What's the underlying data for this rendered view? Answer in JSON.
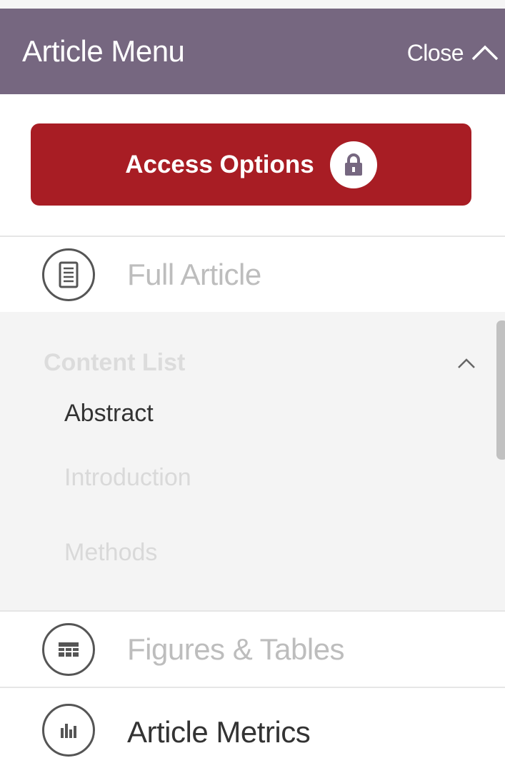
{
  "header": {
    "title": "Article Menu",
    "close_label": "Close"
  },
  "access": {
    "label": "Access Options"
  },
  "menu": {
    "full_article": "Full Article",
    "figures_tables": "Figures & Tables",
    "article_metrics": "Article Metrics"
  },
  "content_list": {
    "title": "Content List",
    "items": [
      "Abstract",
      "Introduction",
      "Methods"
    ]
  },
  "colors": {
    "header_bg": "#766780",
    "access_bg": "#a81d24",
    "content_bg": "#f4f4f4",
    "text_dark": "#333333",
    "text_muted": "#bdbdbd",
    "text_faint": "#d9d9d9"
  },
  "icons": {
    "close": "chevron-up-icon",
    "access": "lock-icon",
    "full_article": "document-icon",
    "figures_tables": "table-icon",
    "article_metrics": "bar-chart-icon",
    "content_collapse": "chevron-up-icon"
  }
}
